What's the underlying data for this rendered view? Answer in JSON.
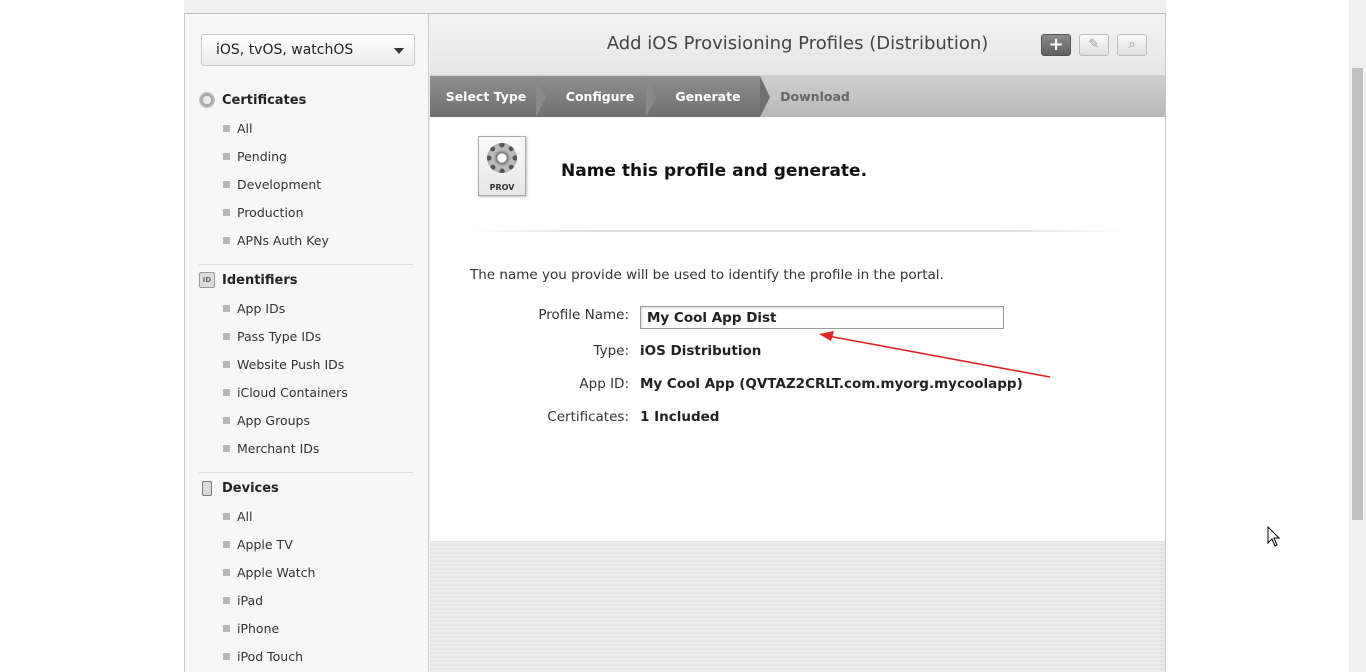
{
  "sidebar": {
    "platform_select": "iOS, tvOS, watchOS",
    "sections": [
      {
        "title": "Certificates",
        "icon": "certificate-icon",
        "items": [
          "All",
          "Pending",
          "Development",
          "Production",
          "APNs Auth Key"
        ]
      },
      {
        "title": "Identifiers",
        "icon": "id-icon",
        "items": [
          "App IDs",
          "Pass Type IDs",
          "Website Push IDs",
          "iCloud Containers",
          "App Groups",
          "Merchant IDs"
        ]
      },
      {
        "title": "Devices",
        "icon": "device-icon",
        "items": [
          "All",
          "Apple TV",
          "Apple Watch",
          "iPad",
          "iPhone",
          "iPod Touch"
        ]
      }
    ]
  },
  "header": {
    "title": "Add iOS Provisioning Profiles (Distribution)",
    "buttons": {
      "add": "+",
      "edit": "✎",
      "search": "⌕"
    }
  },
  "steps": [
    "Select Type",
    "Configure",
    "Generate",
    "Download"
  ],
  "content": {
    "icon_label": "PROV",
    "headline": "Name this profile and generate.",
    "intro": "The name you provide will be used to identify the profile in the portal.",
    "profile_name_label": "Profile Name:",
    "profile_name_value": "My Cool App Dist",
    "type_label": "Type:",
    "type_value": "iOS Distribution",
    "appid_label": "App ID:",
    "appid_value": "My Cool App (QVTAZ2CRLT.com.myorg.mycoolapp)",
    "certs_label": "Certificates:",
    "certs_value": "1 Included"
  },
  "colors": {
    "annotation_arrow": "#e02424",
    "step_active": "#6f6f6f"
  }
}
